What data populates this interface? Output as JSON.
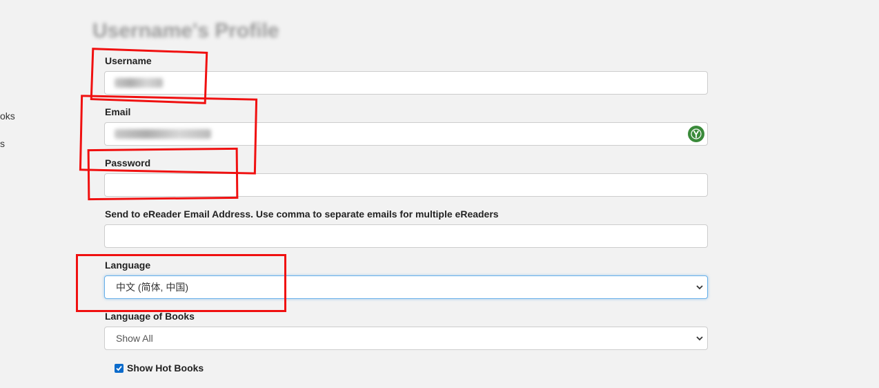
{
  "sidebar": {
    "items": [
      {
        "label": "oks"
      },
      {
        "label": "s"
      }
    ]
  },
  "page": {
    "title": "Username's Profile"
  },
  "form": {
    "username": {
      "label": "Username",
      "value": ""
    },
    "email": {
      "label": "Email",
      "value": ""
    },
    "password": {
      "label": "Password",
      "value": ""
    },
    "kindle": {
      "label": "Send to eReader Email Address. Use comma to separate emails for multiple eReaders",
      "value": ""
    },
    "language": {
      "label": "Language",
      "selected": "中文 (简体, 中国)"
    },
    "book_language": {
      "label": "Language of Books",
      "selected": "Show All"
    },
    "hot_books": {
      "label": "Show Hot Books",
      "checked": true
    }
  },
  "icons": {
    "password_manager": "password-manager-icon",
    "chevron": "chevron-down-icon",
    "checkmark": "checkmark-icon"
  },
  "colors": {
    "annotation": "#f01010",
    "checkbox": "#0b6bcb",
    "focus": "#66afe9",
    "password_manager": "#3a8a3a"
  }
}
